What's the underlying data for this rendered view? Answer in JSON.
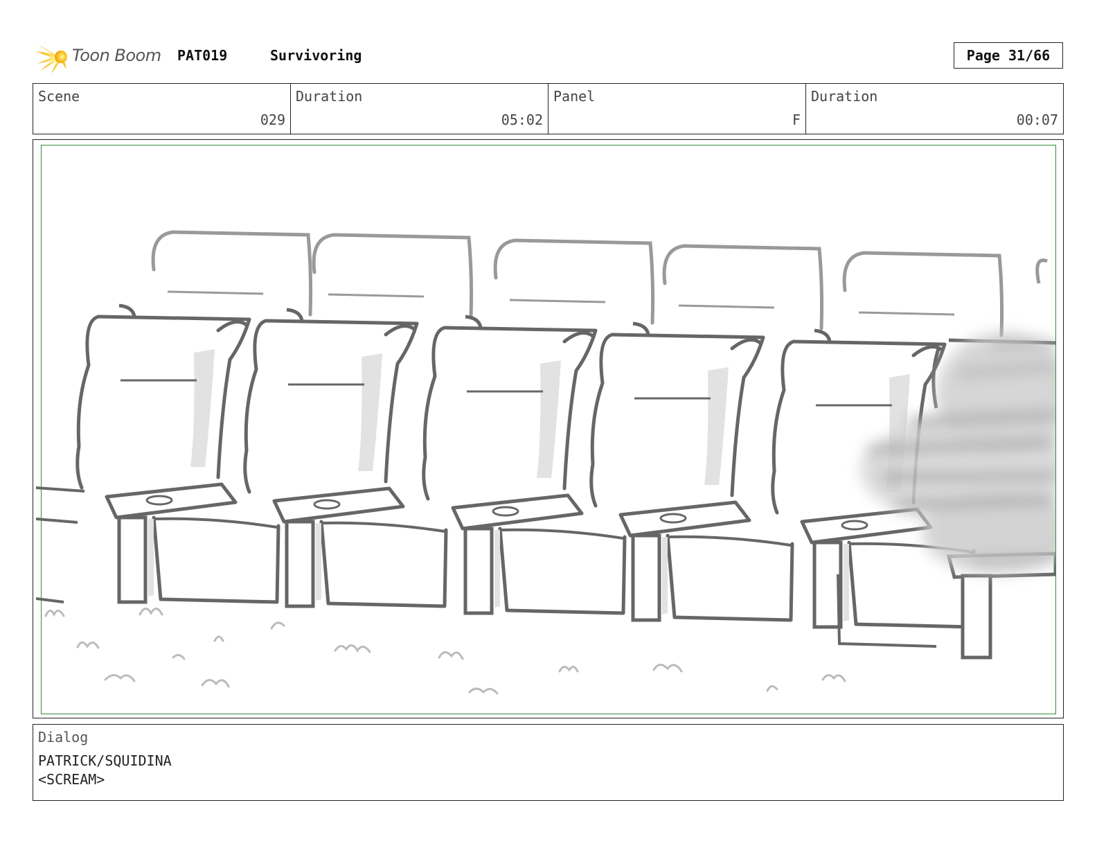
{
  "header": {
    "logo_text": "Toon Boom",
    "project_code": "PAT019",
    "project_title": "Survivoring",
    "page_label": "Page 31/66"
  },
  "info": {
    "scene_label": "Scene",
    "scene_value": "029",
    "scene_duration_label": "Duration",
    "scene_duration_value": "05:02",
    "panel_label": "Panel",
    "panel_value": "F",
    "panel_duration_label": "Duration",
    "panel_duration_value": "00:07"
  },
  "panel": {
    "icon": "theater-seats-sketch"
  },
  "dialog": {
    "label": "Dialog",
    "lines": [
      "PATRICK/SQUIDINA",
      "<SCREAM>"
    ]
  },
  "colors": {
    "safe_frame": "#2e8b3a",
    "sketch_line": "#666666",
    "sketch_shade": "#e2e2e2"
  }
}
